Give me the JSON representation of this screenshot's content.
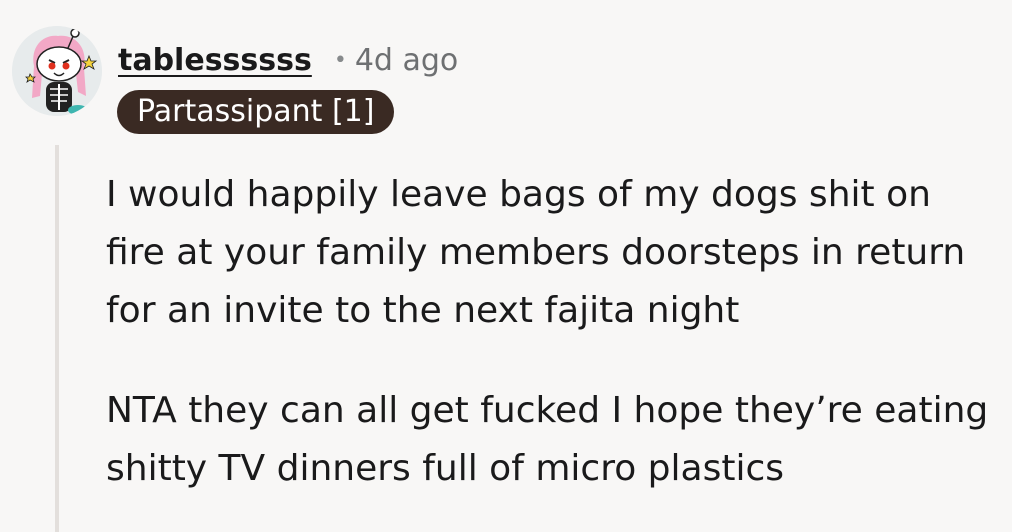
{
  "comment": {
    "author": {
      "username": "tablessssss",
      "flair": "Partassipant [1]",
      "avatar_icon": "snoo-skeleton-avatar-icon"
    },
    "separator": "•",
    "timestamp": "4d ago",
    "paragraphs": [
      "I would happily leave bags of my dogs shit on fire at your family members doorsteps in return for an invite to the next fajita night",
      "NTA they can all get fucked I hope they’re eating shitty TV dinners full of micro plastics"
    ]
  },
  "colors": {
    "background": "#f8f7f6",
    "flair_background": "#3a2a23",
    "flair_text": "#ffffff",
    "thread_line": "#e3dfdc",
    "meta_text": "#6e7072"
  }
}
